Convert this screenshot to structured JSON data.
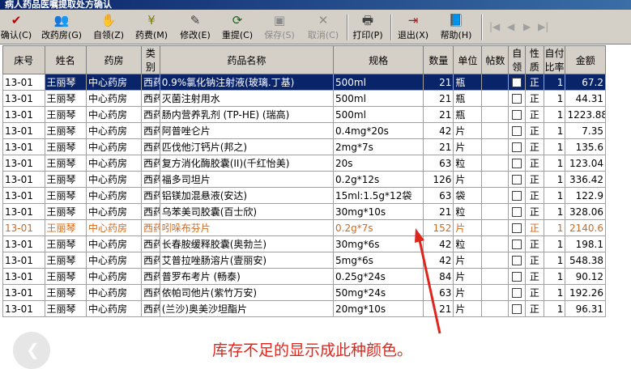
{
  "window": {
    "title": "病人药品医嘱提取处方确认"
  },
  "toolbar": {
    "buttons": [
      {
        "label": "确认(C)",
        "icon": "check"
      },
      {
        "label": "改药房(G)",
        "icon": "people"
      },
      {
        "label": "自领(Z)",
        "icon": "hand"
      },
      {
        "label": "药费(M)",
        "icon": "money"
      },
      {
        "label": "修改(E)",
        "icon": "edit"
      },
      {
        "label": "重提(C)",
        "icon": "redo"
      },
      {
        "label": "保存(S)",
        "icon": "save"
      },
      {
        "label": "取消(C)",
        "icon": "cancel"
      },
      {
        "label": "打印(P)",
        "icon": "printer"
      },
      {
        "label": "退出(X)",
        "icon": "exit"
      },
      {
        "label": "帮助(H)",
        "icon": "book"
      }
    ],
    "nav_glyphs": [
      "|◀",
      "◀",
      "▶",
      "▶|"
    ]
  },
  "table": {
    "headers": [
      "床号",
      "姓名",
      "药房",
      "类别",
      "药品名称",
      "规格",
      "数量",
      "单位",
      "帖数",
      "自领",
      "性质",
      "自付比率",
      "金额"
    ],
    "rows": [
      {
        "bed": "13-01",
        "name": "王丽琴",
        "pharmacy": "中心药房",
        "type": "西药",
        "drug": "0.9%氯化钠注射液(玻璃.丁基)",
        "spec": "500ml",
        "qty": "21",
        "unit": "瓶",
        "doses": "",
        "self": "",
        "nature": "正",
        "rate": "1",
        "amount": "67.2",
        "state": "selected"
      },
      {
        "bed": "13-01",
        "name": "王丽琴",
        "pharmacy": "中心药房",
        "type": "西药",
        "drug": "灭菌注射用水",
        "spec": "500ml",
        "qty": "21",
        "unit": "瓶",
        "doses": "",
        "self": "",
        "nature": "正",
        "rate": "1",
        "amount": "44.31",
        "state": ""
      },
      {
        "bed": "13-01",
        "name": "王丽琴",
        "pharmacy": "中心药房",
        "type": "西药",
        "drug": "肠内营养乳剂 (TP-HE) (瑞高)",
        "spec": "500ml",
        "qty": "21",
        "unit": "瓶",
        "doses": "",
        "self": "",
        "nature": "正",
        "rate": "1",
        "amount": "1223.88",
        "state": ""
      },
      {
        "bed": "13-01",
        "name": "王丽琴",
        "pharmacy": "中心药房",
        "type": "西药",
        "drug": "阿普唑仑片",
        "spec": "0.4mg*20s",
        "qty": "42",
        "unit": "片",
        "doses": "",
        "self": "",
        "nature": "正",
        "rate": "1",
        "amount": "7.35",
        "state": ""
      },
      {
        "bed": "13-01",
        "name": "王丽琴",
        "pharmacy": "中心药房",
        "type": "西药",
        "drug": "匹伐他汀钙片(邦之)",
        "spec": "2mg*7s",
        "qty": "21",
        "unit": "片",
        "doses": "",
        "self": "",
        "nature": "正",
        "rate": "1",
        "amount": "135.6",
        "state": ""
      },
      {
        "bed": "13-01",
        "name": "王丽琴",
        "pharmacy": "中心药房",
        "type": "西药",
        "drug": "复方消化酶胶囊(II)(千红怡美)",
        "spec": "20s",
        "qty": "63",
        "unit": "粒",
        "doses": "",
        "self": "",
        "nature": "正",
        "rate": "1",
        "amount": "123.04",
        "state": ""
      },
      {
        "bed": "13-01",
        "name": "王丽琴",
        "pharmacy": "中心药房",
        "type": "西药",
        "drug": "福多司坦片",
        "spec": "0.2g*12s",
        "qty": "126",
        "unit": "片",
        "doses": "",
        "self": "",
        "nature": "正",
        "rate": "1",
        "amount": "336.42",
        "state": ""
      },
      {
        "bed": "13-01",
        "name": "王丽琴",
        "pharmacy": "中心药房",
        "type": "西药",
        "drug": "铝镁加混悬液(安达)",
        "spec": "15ml:1.5g*12袋",
        "qty": "63",
        "unit": "袋",
        "doses": "",
        "self": "",
        "nature": "正",
        "rate": "1",
        "amount": "122.9",
        "state": ""
      },
      {
        "bed": "13-01",
        "name": "王丽琴",
        "pharmacy": "中心药房",
        "type": "西药",
        "drug": "乌苯美司胶囊(百士欣)",
        "spec": "30mg*10s",
        "qty": "21",
        "unit": "粒",
        "doses": "",
        "self": "",
        "nature": "正",
        "rate": "1",
        "amount": "328.06",
        "state": ""
      },
      {
        "bed": "13-01",
        "name": "王丽琴",
        "pharmacy": "中心药房",
        "type": "西药",
        "drug": "吲哚布芬片",
        "spec": "0.2g*7s",
        "qty": "152",
        "unit": "片",
        "doses": "",
        "self": "",
        "nature": "正",
        "rate": "1",
        "amount": "2140.6",
        "state": "low"
      },
      {
        "bed": "13-01",
        "name": "王丽琴",
        "pharmacy": "中心药房",
        "type": "西药",
        "drug": "长春胺缓释胶囊(奥勃兰)",
        "spec": "30mg*6s",
        "qty": "42",
        "unit": "粒",
        "doses": "",
        "self": "",
        "nature": "正",
        "rate": "1",
        "amount": "198.1",
        "state": ""
      },
      {
        "bed": "13-01",
        "name": "王丽琴",
        "pharmacy": "中心药房",
        "type": "西药",
        "drug": "艾普拉唑肠溶片(壹丽安)",
        "spec": "5mg*6s",
        "qty": "42",
        "unit": "片",
        "doses": "",
        "self": "",
        "nature": "正",
        "rate": "1",
        "amount": "548.38",
        "state": ""
      },
      {
        "bed": "13-01",
        "name": "王丽琴",
        "pharmacy": "中心药房",
        "type": "西药",
        "drug": "普罗布考片 (畅泰)",
        "spec": "0.25g*24s",
        "qty": "84",
        "unit": "片",
        "doses": "",
        "self": "",
        "nature": "正",
        "rate": "1",
        "amount": "90.12",
        "state": ""
      },
      {
        "bed": "13-01",
        "name": "王丽琴",
        "pharmacy": "中心药房",
        "type": "西药",
        "drug": "依帕司他片(紫竹万安)",
        "spec": "50mg*24s",
        "qty": "63",
        "unit": "片",
        "doses": "",
        "self": "",
        "nature": "正",
        "rate": "1",
        "amount": "192.26",
        "state": ""
      },
      {
        "bed": "13-01",
        "name": "王丽琴",
        "pharmacy": "中心药房",
        "type": "西药",
        "drug": "(兰沙)奥美沙坦酯片",
        "spec": "20mg*10s",
        "qty": "21",
        "unit": "片",
        "doses": "",
        "self": "",
        "nature": "正",
        "rate": "1",
        "amount": "96.31",
        "state": ""
      }
    ]
  },
  "annotation": {
    "text": "库存不足的显示成此种颜色。",
    "color": "#e0251c"
  },
  "colors": {
    "low_stock": "#d2691e",
    "selection": "#0a246a"
  }
}
